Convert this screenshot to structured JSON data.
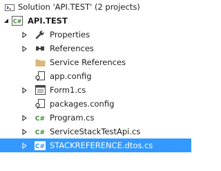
{
  "solution_explorer": {
    "solution_label": "Solution 'API.TEST' (2 projects)",
    "project_label": "API.TEST",
    "project_icon_text": "C#",
    "items": [
      {
        "label": "Properties"
      },
      {
        "label": "References"
      },
      {
        "label": "Service References"
      },
      {
        "label": "app.config"
      },
      {
        "label": "Form1.cs"
      },
      {
        "label": "packages.config"
      },
      {
        "label": "Program.cs",
        "icon_text": "C#"
      },
      {
        "label": "ServiceStackTestApi.cs",
        "icon_text": "C#"
      },
      {
        "label": "STACKREFERENCE.dtos.cs",
        "icon_text": "C#",
        "selected": true
      }
    ]
  },
  "colors": {
    "selection": "#3399ff",
    "csharp_green": "#388a34",
    "folder_yellow": "#dcb67a"
  }
}
